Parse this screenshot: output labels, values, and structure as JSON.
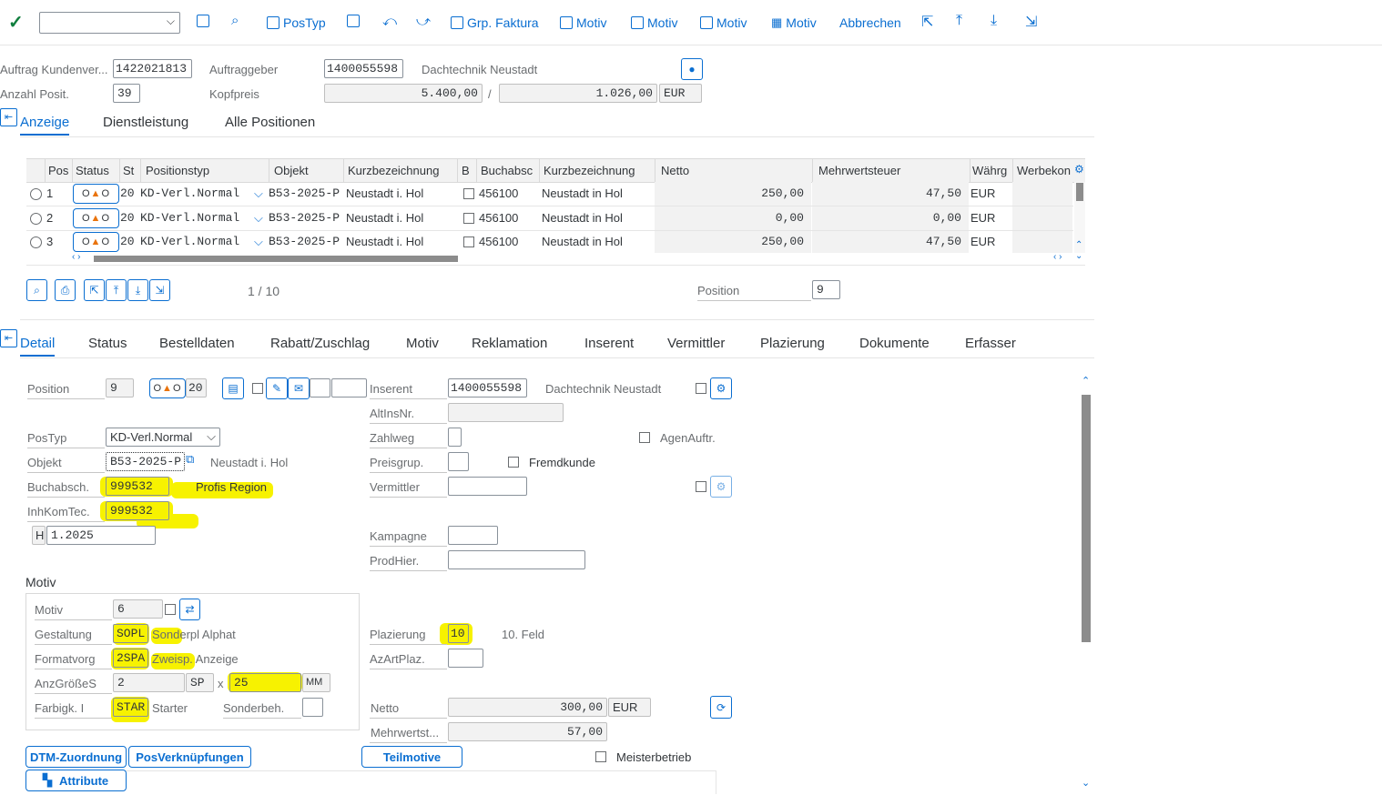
{
  "toolbar": {
    "command_value": "",
    "buttons": [
      {
        "label": "PosTyp"
      },
      {
        "label": "Grp. Faktura"
      },
      {
        "label": "Motiv"
      },
      {
        "label": "Motiv"
      },
      {
        "label": "Motiv"
      },
      {
        "label": "Motiv"
      },
      {
        "label": "Abbrechen"
      }
    ]
  },
  "header": {
    "auftrag_label": "Auftrag Kundenver...",
    "auftrag_value": "1422021813",
    "auftraggeber_label": "Auftraggeber",
    "auftraggeber_value": "1400055598",
    "auftraggeber_name": "Dachtechnik Neustadt",
    "anzahl_label": "Anzahl Posit.",
    "anzahl_value": "39",
    "kopfpreis_label": "Kopfpreis",
    "kopfpreis_value": "5.400,00",
    "slash": "/",
    "kopfpreis_tax": "1.026,00",
    "currency": "EUR"
  },
  "top_tabs": [
    {
      "label": "Anzeige",
      "active": true
    },
    {
      "label": "Dienstleistung",
      "active": false
    },
    {
      "label": "Alle Positionen",
      "active": false
    }
  ],
  "grid": {
    "columns": [
      "Pos",
      "Status",
      "St",
      "Positionstyp",
      "Objekt",
      "Kurzbezeichnung",
      "B",
      "Buchabsc",
      "Kurzbezeichnung",
      "Netto",
      "Mehrwertsteuer",
      "Währg",
      "Werbekon"
    ],
    "rows": [
      {
        "pos": "1",
        "st": "20",
        "postyp": "KD-Verl.Normal",
        "objekt": "B53-2025-P",
        "kurz": "Neustadt i. Hol",
        "buch": "456100",
        "kurz2": "Neustadt in Hol",
        "netto": "250,00",
        "mwst": "47,50",
        "waehrung": "EUR"
      },
      {
        "pos": "2",
        "st": "20",
        "postyp": "KD-Verl.Normal",
        "objekt": "B53-2025-P",
        "kurz": "Neustadt i. Hol",
        "buch": "456100",
        "kurz2": "Neustadt in Hol",
        "netto": "0,00",
        "mwst": "0,00",
        "waehrung": "EUR"
      },
      {
        "pos": "3",
        "st": "20",
        "postyp": "KD-Verl.Normal",
        "objekt": "B53-2025-P",
        "kurz": "Neustadt i. Hol",
        "buch": "456100",
        "kurz2": "Neustadt in Hol",
        "netto": "250,00",
        "mwst": "47,50",
        "waehrung": "EUR"
      }
    ],
    "pager": "1 / 10",
    "position_label": "Position",
    "position_value": "9"
  },
  "detail_tabs": [
    {
      "label": "Detail",
      "active": true
    },
    {
      "label": "Status"
    },
    {
      "label": "Bestelldaten"
    },
    {
      "label": "Rabatt/Zuschlag"
    },
    {
      "label": "Motiv"
    },
    {
      "label": "Reklamation"
    },
    {
      "label": "Inserent"
    },
    {
      "label": "Vermittler"
    },
    {
      "label": "Plazierung"
    },
    {
      "label": "Dokumente"
    },
    {
      "label": "Erfasser"
    }
  ],
  "detail": {
    "position_label": "Position",
    "position_value": "9",
    "status_value": "20",
    "postyp_label": "PosTyp",
    "postyp_value": "KD-Verl.Normal",
    "objekt_label": "Objekt",
    "objekt_value": "B53-2025-P",
    "objekt_text": "Neustadt i. Hol",
    "buchabsch_label": "Buchabsch.",
    "buchabsch_value": "999532",
    "buchabsch_text": "Profis Region",
    "inhkomtec_label": "InhKomTec.",
    "inhkomtec_value": "999532",
    "h_value": "H",
    "date_value": "1.2025",
    "inserent_label": "Inserent",
    "inserent_value": "1400055598",
    "inserent_name": "Dachtechnik Neustadt",
    "altinsnr_label": "AltInsNr.",
    "zahlweg_label": "Zahlweg",
    "agenauftr_label": "AgenAuftr.",
    "preisgrup_label": "Preisgrup.",
    "fremdkunde_label": "Fremdkunde",
    "vermittler_label": "Vermittler",
    "kampagne_label": "Kampagne",
    "prodhier_label": "ProdHier."
  },
  "motiv": {
    "title": "Motiv",
    "motiv_label": "Motiv",
    "motiv_value": "6",
    "gestaltung_label": "Gestaltung",
    "gestaltung_code": "SOPL",
    "gestaltung_text": "Sonderpl Alphat",
    "formatvorg_label": "Formatvorg",
    "formatvorg_code": "2SPA",
    "formatvorg_text": "Zweisp. Anzeige",
    "anzgroesse_label": "AnzGrößeS",
    "anzgroesse_value": "2",
    "anzgroesse_unit": "SP",
    "times": "x",
    "anzgroesse_height": "25",
    "anzgroesse_height_unit": "MM",
    "farbigk_label": "Farbigk. I",
    "farbigk_code": "STAR",
    "farbigk_text": "Starter",
    "sonderbeh_label": "Sonderbeh."
  },
  "plazierung": {
    "plazierung_label": "Plazierung",
    "plazierung_value": "10",
    "plazierung_text": "10. Feld",
    "azartplaz_label": "AzArtPlaz.",
    "netto_label": "Netto",
    "netto_value": "300,00",
    "netto_currency": "EUR",
    "mwst_label": "Mehrwertst...",
    "mwst_value": "57,00"
  },
  "buttons": {
    "dtm": "DTM-Zuordnung",
    "posverk": "PosVerknüpfungen",
    "teilmotive": "Teilmotive",
    "meisterbetrieb": "Meisterbetrieb",
    "attribute": "Attribute"
  },
  "colors": {
    "accent": "#0a6ed1",
    "highlight": "#f7f200",
    "ok_check": "#107e3e"
  }
}
